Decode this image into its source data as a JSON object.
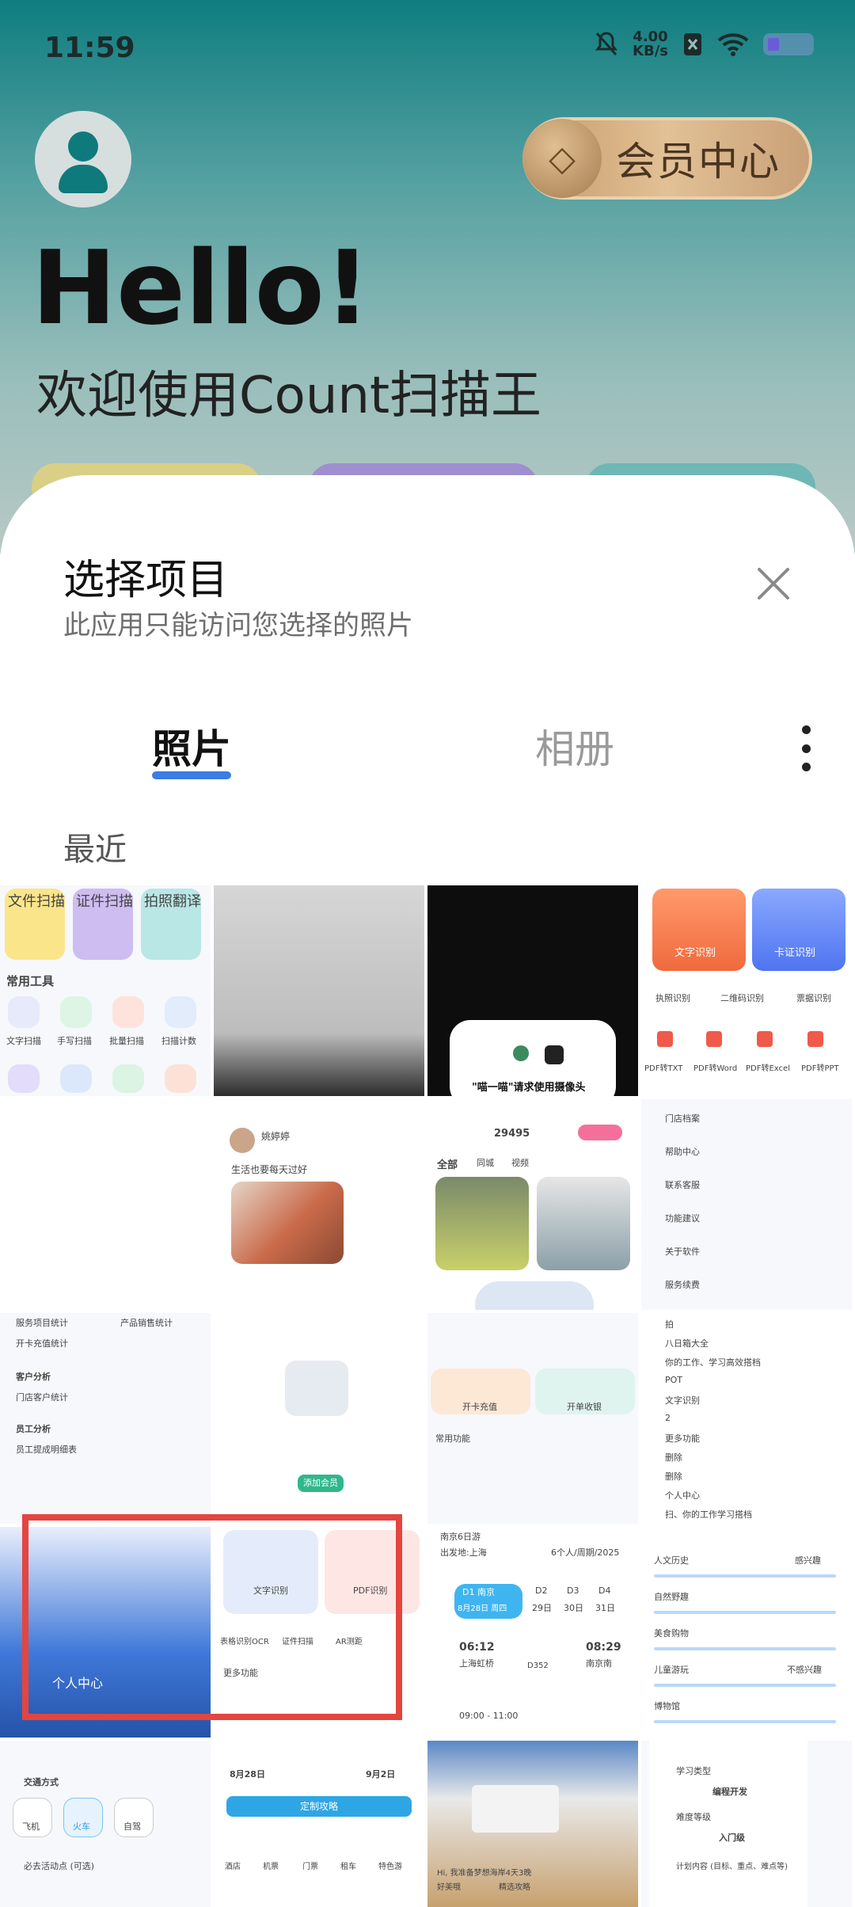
{
  "status_bar": {
    "time": "11:59",
    "net_speed_value": "4.00",
    "net_speed_unit": "KB/s",
    "icons": [
      "mute-icon",
      "sim-off-icon",
      "wifi-icon",
      "battery-icon"
    ]
  },
  "app": {
    "greeting": "Hello!",
    "welcome": "欢迎使用Count扫描王",
    "vip_label": "会员中心"
  },
  "picker": {
    "title": "选择项目",
    "subtitle": "此应用只能访问您选择的照片",
    "tabs": [
      {
        "label": "照片",
        "active": true
      },
      {
        "label": "相册",
        "active": false
      }
    ],
    "section": "最近",
    "accent_color": "#3b7de3"
  },
  "thumbnails": [
    {
      "texts": [
        "文件扫描",
        "证件扫描",
        "拍照翻译",
        "常用工具",
        "文字扫描",
        "手写扫描",
        "批量扫描",
        "扫描计数"
      ]
    },
    {
      "texts": []
    },
    {
      "texts": [
        "\"喵一喵\"请求使用摄像头"
      ]
    },
    {
      "texts": [
        "文字识别",
        "卡证识别",
        "执照识别",
        "二维码识别",
        "票据识别",
        "PDF转TXT",
        "PDF转Word",
        "PDF转Excel",
        "PDF转PPT"
      ]
    },
    {
      "texts": []
    },
    {
      "texts": [
        "姚婷婷",
        "生活也要每天过好"
      ]
    },
    {
      "texts": [
        "29495",
        "全部",
        "同城",
        "视频"
      ]
    },
    {
      "texts": [
        "门店档案",
        "帮助中心",
        "联系客服",
        "功能建议",
        "关于软件",
        "服务续费"
      ]
    },
    {
      "texts": [
        "服务项目统计",
        "产品销售统计",
        "开卡充值统计",
        "客户分析",
        "门店客户统计",
        "员工分析",
        "员工提成明细表"
      ]
    },
    {
      "texts": [
        "添加会员"
      ]
    },
    {
      "texts": [
        "开卡充值",
        "开单收银",
        "常用功能"
      ]
    },
    {
      "texts": [
        "拍",
        "八日箱大全",
        "你的工作、学习高效搭档",
        "POT",
        "文字识别",
        "2",
        "更多功能",
        "删除",
        "删除",
        "个人中心",
        "扫、你的工作学习搭档"
      ]
    },
    {
      "texts": [
        "个人中心"
      ]
    },
    {
      "texts": [
        "文字识别",
        "PDF识别",
        "表格识别OCR",
        "证件扫描",
        "AR测距",
        "更多功能"
      ]
    },
    {
      "texts": [
        "南京6日游",
        "出发地:上海",
        "6个人/周期/2025",
        "D1 南京",
        "8月28日 周四",
        "D2",
        "29日",
        "D3",
        "30日",
        "D4",
        "31日",
        "06:12",
        "上海虹桥",
        "08:29",
        "南京南",
        "D352",
        "09:00 - 11:00"
      ]
    },
    {
      "texts": [
        "人文历史",
        "自然野趣",
        "美食购物",
        "儿童游玩",
        "博物馆",
        "感兴趣",
        "不感兴趣"
      ]
    },
    {
      "texts": [
        "交通方式",
        "飞机",
        "火车",
        "自驾",
        "必去活动点 (可选)"
      ]
    },
    {
      "texts": [
        "8月28日",
        "9月2日",
        "定制攻略",
        "酒店",
        "机票",
        "门票",
        "租车",
        "特色游"
      ]
    },
    {
      "texts": [
        "Hi, 我准备梦想海岸4天3晚",
        "好美哦",
        "精选攻略"
      ]
    },
    {
      "texts": [
        "学习类型",
        "编程开发",
        "难度等级",
        "入门级",
        "计划内容 (目标、重点、难点等)"
      ]
    }
  ]
}
